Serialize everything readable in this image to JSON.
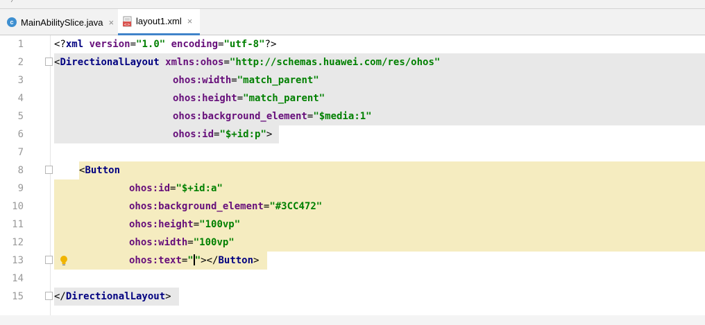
{
  "tabs": [
    {
      "label": "MainAbilitySlice.java",
      "icon": "java-class-icon",
      "active": false
    },
    {
      "label": "layout1.xml",
      "icon": "xml-file-icon",
      "active": true
    }
  ],
  "close_glyph": "×",
  "line_numbers": [
    "1",
    "2",
    "3",
    "4",
    "5",
    "6",
    "7",
    "8",
    "9",
    "10",
    "11",
    "12",
    "13",
    "14",
    "15"
  ],
  "code": {
    "l1": {
      "a": "<?",
      "b": "xml ",
      "c": "version",
      "d": "=",
      "e": "\"1.0\"",
      "f": " ",
      "g": "encoding",
      "h": "=",
      "i": "\"utf-8\"",
      "j": "?>"
    },
    "l2": {
      "a": "<",
      "b": "DirectionalLayout ",
      "c": "xmlns:",
      "d": "ohos",
      "e": "=",
      "f": "\"http://schemas.huawei.com/res/ohos\""
    },
    "l3": {
      "a": "ohos:width",
      "b": "=",
      "c": "\"match_parent\""
    },
    "l4": {
      "a": "ohos:height",
      "b": "=",
      "c": "\"match_parent\""
    },
    "l5": {
      "a": "ohos:background_element",
      "b": "=",
      "c": "\"$media:1\""
    },
    "l6": {
      "a": "ohos:id",
      "b": "=",
      "c": "\"$+id:p\"",
      "d": ">"
    },
    "l8": {
      "a": "<",
      "b": "Button"
    },
    "l9": {
      "a": "ohos:id",
      "b": "=",
      "c": "\"$+id:a\""
    },
    "l10": {
      "a": "ohos:background_element",
      "b": "=",
      "c": "\"#3CC472\""
    },
    "l11": {
      "a": "ohos:height",
      "b": "=",
      "c": "\"100vp\""
    },
    "l12": {
      "a": "ohos:width",
      "b": "=",
      "c": "\"100vp\""
    },
    "l13": {
      "a": "ohos:text",
      "b": "=",
      "c": "\"",
      "d": "\"",
      "e": "></",
      "f": "Button",
      "g": ">"
    },
    "l15": {
      "a": "</",
      "b": "DirectionalLayout",
      "c": ">"
    }
  },
  "colors": {
    "tag": "#000080",
    "attribute": "#660e7a",
    "value": "#008000",
    "tag_highlight": "#e8e8e8",
    "button_highlight": "#f5ecc0",
    "accent": "#4083c9"
  }
}
